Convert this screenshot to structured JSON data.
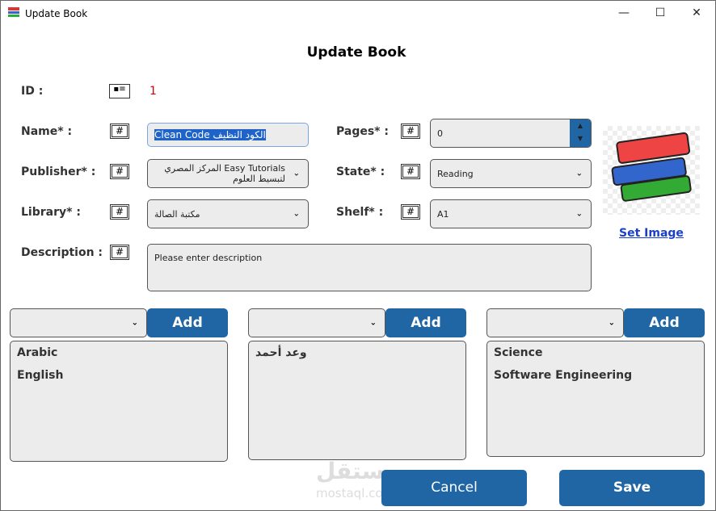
{
  "window": {
    "title": "Update Book",
    "minimize": "—",
    "maximize": "☐",
    "close": "✕"
  },
  "heading": "Update Book",
  "fields": {
    "id": {
      "label": "ID :",
      "value": "1"
    },
    "name": {
      "label": "Name* :",
      "value": "Clean Code الكود النظيف"
    },
    "publisher": {
      "label": "Publisher* :",
      "value": "Easy  Tutorials  المركز المصري لتبسيط العلوم"
    },
    "library": {
      "label": "Library* :",
      "value": "مكتبة الصالة"
    },
    "description": {
      "label": "Description :",
      "placeholder": "Please enter description"
    },
    "pages": {
      "label": "Pages* :",
      "value": "0"
    },
    "state": {
      "label": "State* :",
      "value": "Reading"
    },
    "shelf": {
      "label": "Shelf* :",
      "value": "A1"
    }
  },
  "set_image": "Set Image",
  "panels": [
    {
      "add": "Add",
      "items": [
        "Arabic",
        "English"
      ]
    },
    {
      "add": "Add",
      "items": [
        "وعد أحمد"
      ]
    },
    {
      "add": "Add",
      "items": [
        "Science",
        "Software Engineering"
      ]
    }
  ],
  "buttons": {
    "cancel": "Cancel",
    "save": "Save"
  },
  "watermark": {
    "arabic": "مستقل",
    "latin": "mostaql.com"
  }
}
